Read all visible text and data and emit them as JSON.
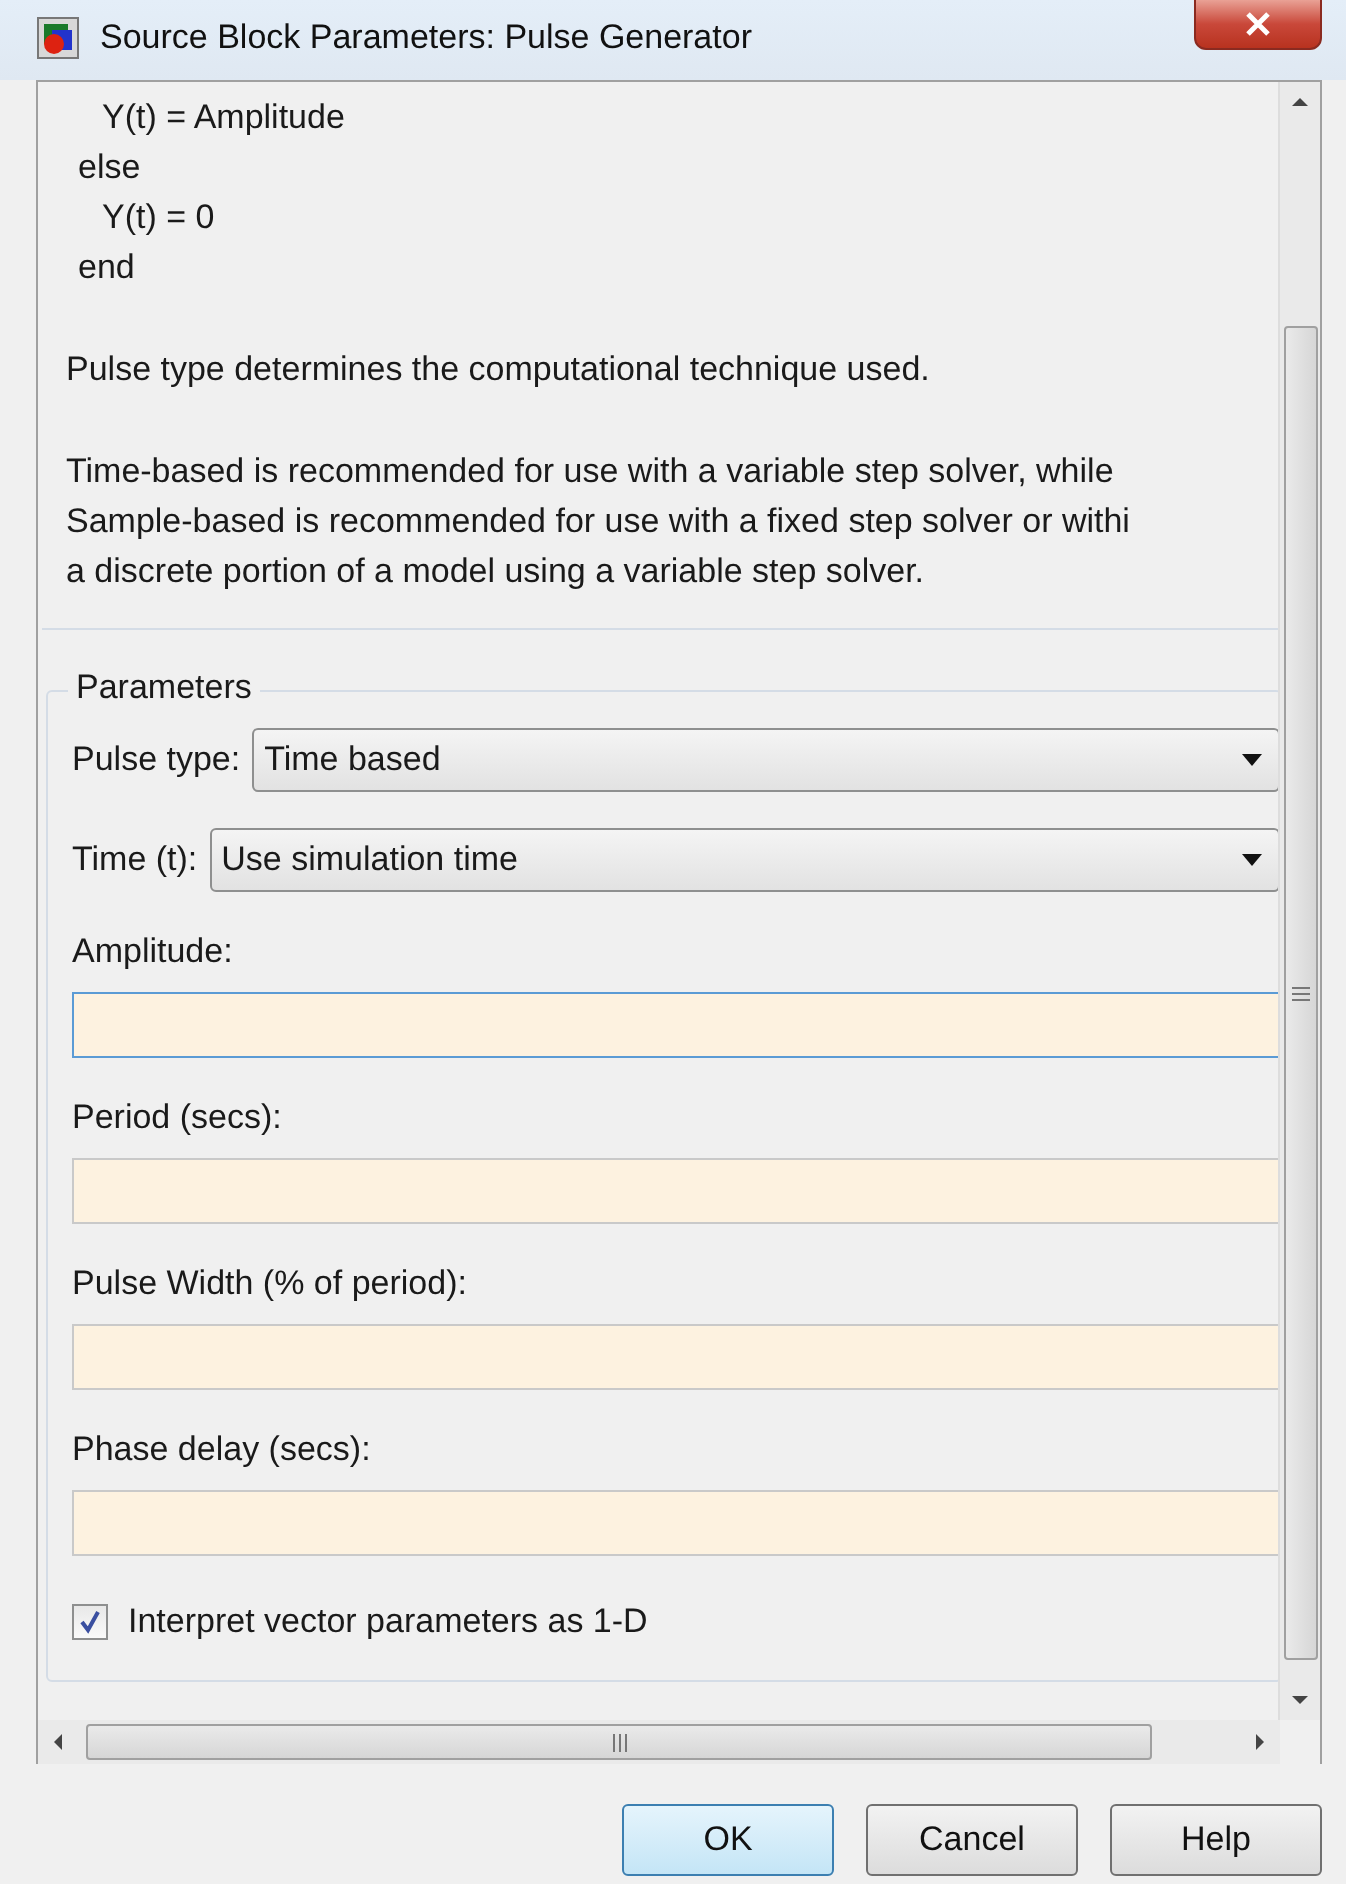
{
  "window": {
    "title": "Source Block Parameters: Pulse Generator"
  },
  "code_lines": [
    {
      "text": "Y(t) = Amplitude",
      "kind": "inner"
    },
    {
      "text": "else",
      "kind": "outer"
    },
    {
      "text": "Y(t) = 0",
      "kind": "inner"
    },
    {
      "text": "end",
      "kind": "outer"
    }
  ],
  "description": [
    {
      "lines": [
        "Pulse type determines the computational technique used."
      ]
    },
    {
      "lines": [
        "Time-based is recommended for use with a variable step solver, while",
        "Sample-based is recommended for use with a fixed step solver or withi",
        "a discrete portion of a model using a variable step solver."
      ]
    }
  ],
  "parameters": {
    "title": "Parameters",
    "dropdowns": [
      {
        "label": "Pulse type:",
        "value": "Time based"
      },
      {
        "label": "Time (t):",
        "value": "Use simulation time"
      }
    ],
    "fields": [
      {
        "label": "Amplitude:",
        "focused": true
      },
      {
        "label": "Period (secs):",
        "focused": false
      },
      {
        "label": "Pulse Width (% of period):",
        "focused": false
      },
      {
        "label": "Phase delay (secs):",
        "focused": false
      }
    ],
    "checkbox": {
      "label": "Interpret vector parameters as 1-D",
      "checked": true
    }
  },
  "buttons": [
    {
      "label": "OK",
      "default": true
    },
    {
      "label": "Cancel",
      "default": false
    },
    {
      "label": "Help",
      "default": false
    }
  ]
}
